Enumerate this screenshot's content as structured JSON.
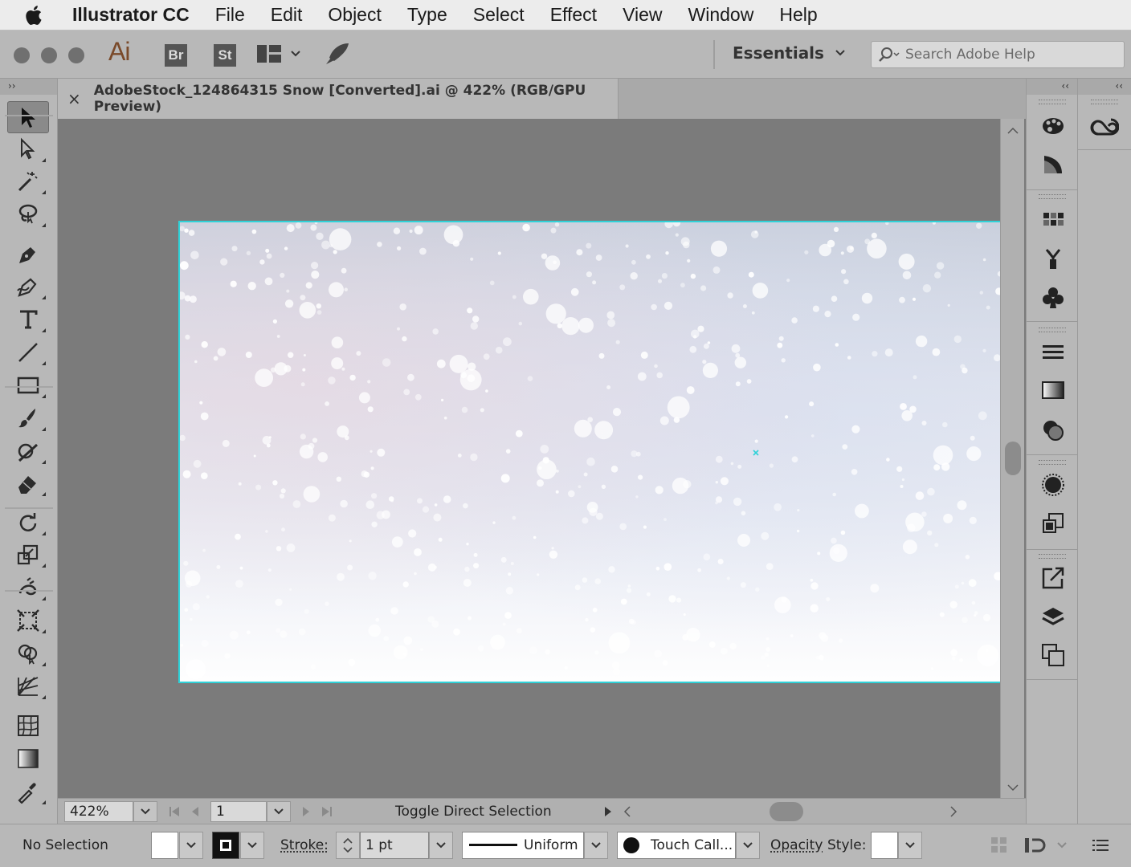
{
  "menubar": {
    "app_name": "Illustrator CC",
    "items": [
      "File",
      "Edit",
      "Object",
      "Type",
      "Select",
      "Effect",
      "View",
      "Window",
      "Help"
    ]
  },
  "toolbar": {
    "app_logo": "Ai",
    "bridge": "Br",
    "stock": "St",
    "workspace": "Essentials",
    "search_placeholder": "Search Adobe Help"
  },
  "tools_panel": {
    "collapse": "››"
  },
  "document": {
    "tab_title": "AdobeStock_124864315 Snow [Converted].ai @ 422% (RGB/GPU Preview)",
    "close_label": "×"
  },
  "statusbar": {
    "zoom": "422%",
    "artboard_number": "1",
    "status_text": "Toggle Direct Selection"
  },
  "right_panel": {
    "collapse_left": "‹‹",
    "collapse_right": "‹‹"
  },
  "controlbar": {
    "selection": "No Selection",
    "stroke_label": "Stroke:",
    "stroke_weight": "1 pt",
    "profile": "Uniform",
    "brush": "Touch Call...",
    "opacity_label": "Opacity",
    "style_label": "Style:"
  },
  "colors": {
    "artboard_border": "#2fd2d8",
    "ai_logo": "#7a4a2a",
    "menubar_bg": "#ececec",
    "ui_bg": "#b8b8b8",
    "canvas_bg": "#7b7b7b"
  },
  "icons": {
    "tools": [
      "selection-tool-icon",
      "direct-selection-tool-icon",
      "magic-wand-tool-icon",
      "lasso-tool-icon",
      "pen-tool-icon",
      "curvature-tool-icon",
      "type-tool-icon",
      "line-tool-icon",
      "rectangle-tool-icon",
      "paintbrush-tool-icon",
      "shaper-tool-icon",
      "eraser-tool-icon",
      "rotate-tool-icon",
      "scale-tool-icon",
      "warp-tool-icon",
      "free-transform-tool-icon",
      "shape-builder-tool-icon",
      "perspective-grid-tool-icon",
      "mesh-tool-icon",
      "gradient-tool-icon",
      "eyedropper-tool-icon"
    ],
    "panels": [
      "color-panel-icon",
      "color-guide-panel-icon",
      "swatches-panel-icon",
      "brushes-panel-icon",
      "symbols-panel-icon",
      "stroke-panel-icon",
      "gradient-panel-icon",
      "transparency-panel-icon",
      "appearance-panel-icon",
      "graphic-styles-panel-icon",
      "export-panel-icon",
      "layers-panel-icon",
      "artboards-panel-icon",
      "creative-cloud-libraries-icon"
    ]
  }
}
